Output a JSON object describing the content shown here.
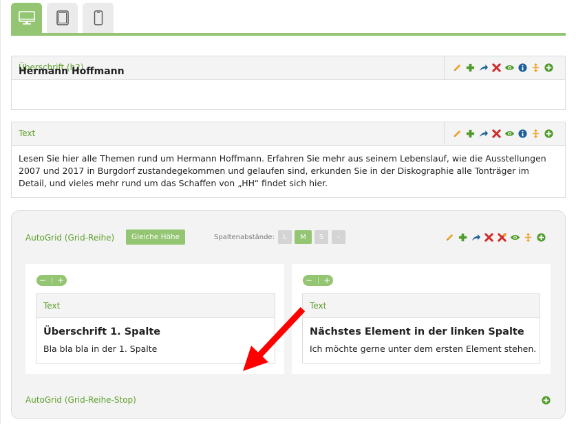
{
  "device_tabs": [
    {
      "name": "desktop",
      "icon": "desktop-monitor-icon",
      "active": true
    },
    {
      "name": "tablet",
      "icon": "tablet-icon",
      "active": false
    },
    {
      "name": "mobile",
      "icon": "smartphone-icon",
      "active": false
    }
  ],
  "colors": {
    "accent_green": "#93c572",
    "label_green": "#5e9f2c",
    "edit_orange": "#f0a020",
    "add_green": "#4e9a2a",
    "move_blue": "#1d5f9a",
    "delete_red": "#d12b2b",
    "info_blue": "#1d5f9a",
    "arrow_red": "#ff0000"
  },
  "toolbar_icons": [
    "edit-pencil-icon",
    "add-plus-icon",
    "move-arrow-icon",
    "delete-x-icon",
    "visibility-eye-icon",
    "info-icon",
    "resize-vertical-icon",
    "add-circle-icon"
  ],
  "heading_element": {
    "type_label": "Überschrift (h2)",
    "content": "Hermann Hoffmann"
  },
  "text_element": {
    "type_label": "Text",
    "content": "Lesen Sie hier alle Themen rund um Hermann Hoffmann. Erfahren Sie mehr aus seinem Lebenslauf, wie die Ausstellungen 2007 und 2017 in Burgdorf zustandegekommen und gelaufen sind, erkunden Sie in der Diskographie alle Tonträger im Detail, und vieles mehr rund um das Schaffen von „HH“ findet sich hier."
  },
  "autogrid": {
    "title": "AutoGrid (Grid-Reihe)",
    "equal_height_button": "Gleiche Höhe",
    "gap_label": "Spaltenabstände:",
    "gap_options": [
      {
        "label": "L",
        "active": false
      },
      {
        "label": "M",
        "active": true
      },
      {
        "label": "S",
        "active": false
      },
      {
        "label": "-",
        "active": false
      }
    ],
    "toolbar_icons": [
      "edit-pencil-icon",
      "add-plus-icon",
      "move-arrow-icon",
      "delete-x-icon",
      "delete-orange-x-icon",
      "visibility-eye-icon",
      "resize-vertical-icon",
      "add-circle-icon"
    ],
    "columns": [
      {
        "minus": "−",
        "plus": "+",
        "type_label": "Text",
        "heading": "Überschrift 1. Spalte",
        "text": "Bla bla bla in der 1. Spalte"
      },
      {
        "minus": "−",
        "plus": "+",
        "type_label": "Text",
        "heading": "Nächstes Element in der linken Spalte",
        "text": "Ich möchte gerne unter dem ersten Element stehen."
      }
    ],
    "stop_label": "AutoGrid (Grid-Reihe-Stop)"
  }
}
